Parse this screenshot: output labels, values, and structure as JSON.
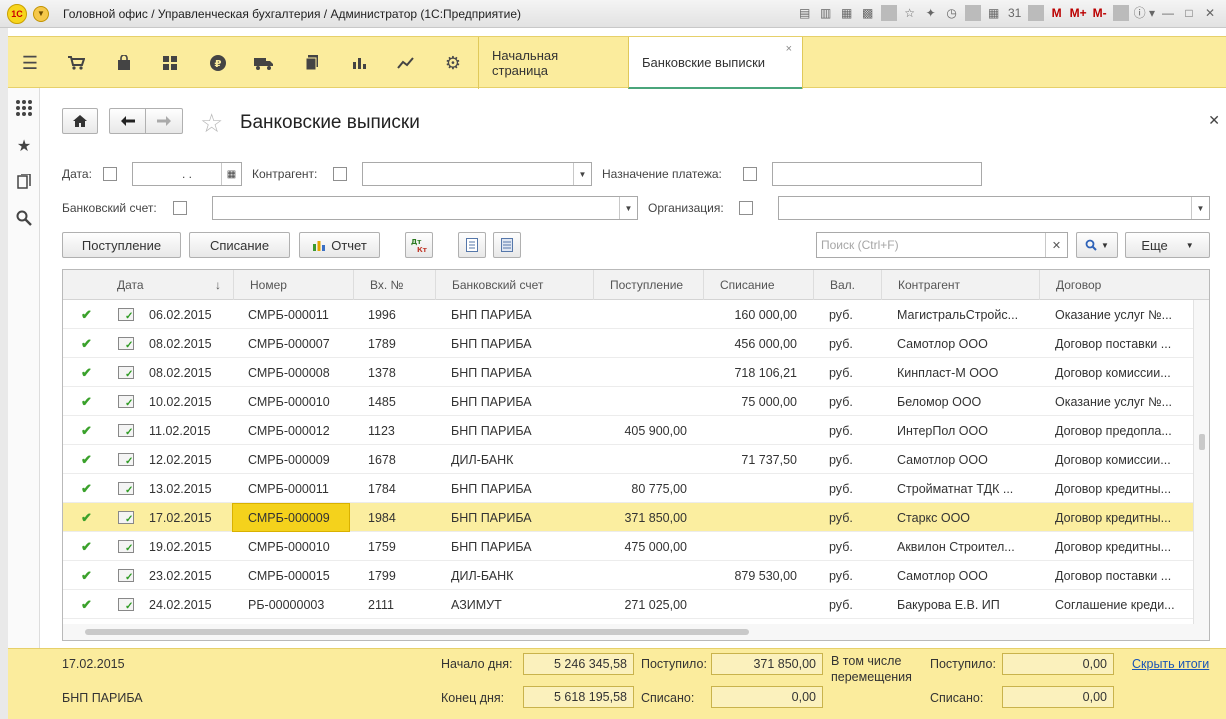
{
  "window": {
    "title": "Головной офис / Управленческая бухгалтерия / Администратор  (1С:Предприятие)",
    "logo_text": "1С",
    "toolbar": {
      "m_label": "M",
      "m_plus_label": "M+",
      "m_minus_label": "M-"
    }
  },
  "tabs": [
    {
      "label": "Начальная страница"
    },
    {
      "label": "Банковские выписки",
      "active": true
    }
  ],
  "form": {
    "title": "Банковские выписки",
    "filters": {
      "date_label": "Дата:",
      "date_value": ". .",
      "counterparty_label": "Контрагент:",
      "payment_purpose_label": "Назначение платежа:",
      "bank_account_label": "Банковский счет:",
      "organization_label": "Организация:"
    },
    "buttons": {
      "receipt": "Поступление",
      "writeoff": "Списание",
      "report": "Отчет",
      "more": "Еще"
    },
    "search": {
      "placeholder": "Поиск (Ctrl+F)"
    }
  },
  "table": {
    "columns": [
      "Дата",
      "Номер",
      "Вх. №",
      "Банковский счет",
      "Поступление",
      "Списание",
      "Вал.",
      "Контрагент",
      "Договор"
    ],
    "sort_indicator": "↓",
    "rows": [
      {
        "date": "06.02.2015",
        "number": "СМРБ-000011",
        "in_no": "1996",
        "account": "БНП ПАРИБА",
        "income": "",
        "expense": "160 000,00",
        "cur": "руб.",
        "counterparty": "МагистральСтройс...",
        "contract": "Оказание услуг №..."
      },
      {
        "date": "08.02.2015",
        "number": "СМРБ-000007",
        "in_no": "1789",
        "account": "БНП ПАРИБА",
        "income": "",
        "expense": "456 000,00",
        "cur": "руб.",
        "counterparty": "Самотлор ООО",
        "contract": "Договор поставки ..."
      },
      {
        "date": "08.02.2015",
        "number": "СМРБ-000008",
        "in_no": "1378",
        "account": "БНП ПАРИБА",
        "income": "",
        "expense": "718 106,21",
        "cur": "руб.",
        "counterparty": "Кинпласт-М ООО",
        "contract": "Договор комиссии..."
      },
      {
        "date": "10.02.2015",
        "number": "СМРБ-000010",
        "in_no": "1485",
        "account": "БНП ПАРИБА",
        "income": "",
        "expense": "75 000,00",
        "cur": "руб.",
        "counterparty": "Беломор ООО",
        "contract": "Оказание услуг №..."
      },
      {
        "date": "11.02.2015",
        "number": "СМРБ-000012",
        "in_no": "1123",
        "account": "БНП ПАРИБА",
        "income": "405 900,00",
        "expense": "",
        "cur": "руб.",
        "counterparty": "ИнтерПол ООО",
        "contract": "Договор предопла..."
      },
      {
        "date": "12.02.2015",
        "number": "СМРБ-000009",
        "in_no": "1678",
        "account": "ДИЛ-БАНК",
        "income": "",
        "expense": "71 737,50",
        "cur": "руб.",
        "counterparty": "Самотлор ООО",
        "contract": "Договор комиссии..."
      },
      {
        "date": "13.02.2015",
        "number": "СМРБ-000011",
        "in_no": "1784",
        "account": "БНП ПАРИБА",
        "income": "80 775,00",
        "expense": "",
        "cur": "руб.",
        "counterparty": "Стройматнат ТДК ...",
        "contract": "Договор кредитны..."
      },
      {
        "date": "17.02.2015",
        "number": "СМРБ-000009",
        "in_no": "1984",
        "account": "БНП ПАРИБА",
        "income": "371 850,00",
        "expense": "",
        "cur": "руб.",
        "counterparty": "Старкс ООО",
        "contract": "Договор кредитны...",
        "selected": true
      },
      {
        "date": "19.02.2015",
        "number": "СМРБ-000010",
        "in_no": "1759",
        "account": "БНП ПАРИБА",
        "income": "475 000,00",
        "expense": "",
        "cur": "руб.",
        "counterparty": "Аквилон Строител...",
        "contract": "Договор кредитны..."
      },
      {
        "date": "23.02.2015",
        "number": "СМРБ-000015",
        "in_no": "1799",
        "account": "ДИЛ-БАНК",
        "income": "",
        "expense": "879 530,00",
        "cur": "руб.",
        "counterparty": "Самотлор ООО",
        "contract": "Договор поставки ..."
      },
      {
        "date": "24.02.2015",
        "number": "РБ-00000003",
        "in_no": "2111",
        "account": "АЗИМУТ",
        "income": "271 025,00",
        "expense": "",
        "cur": "руб.",
        "counterparty": "Бакурова Е.В. ИП",
        "contract": "Соглашение креди..."
      }
    ]
  },
  "totals": {
    "date": "17.02.2015",
    "account": "БНП ПАРИБА",
    "start_label": "Начало дня:",
    "start_value": "5 246 345,58",
    "end_label": "Конец дня:",
    "end_value": "5 618 195,58",
    "received_label": "Поступило:",
    "received_value": "371 850,00",
    "spent_label": "Списано:",
    "spent_value": "0,00",
    "incl_transfers_label": "В том числе перемещения",
    "transfer_received_label": "Поступило:",
    "transfer_received_value": "0,00",
    "transfer_spent_label": "Списано:",
    "transfer_spent_value": "0,00",
    "hide_link": "Скрыть итоги"
  }
}
